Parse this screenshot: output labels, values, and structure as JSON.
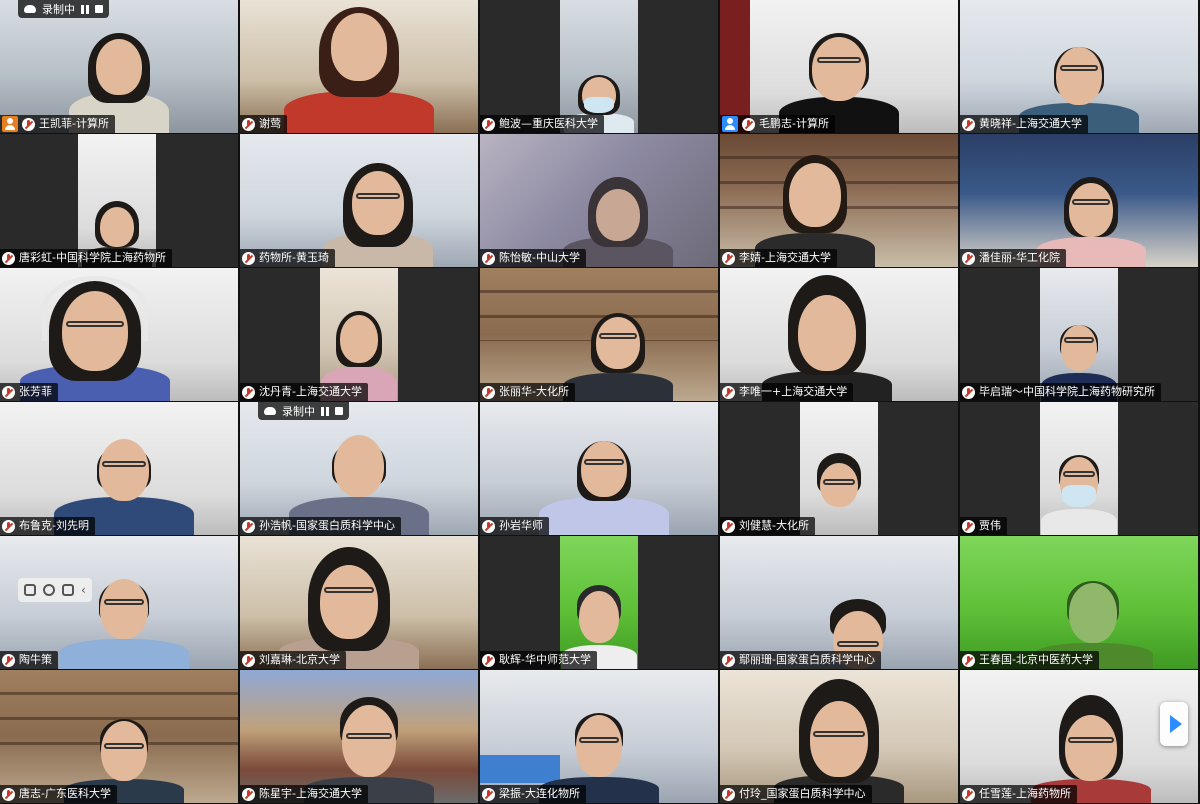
{
  "meeting": {
    "recording_label": "录制中",
    "participants": [
      {
        "name": "王凯菲-计算所",
        "host_badge": "orange",
        "recording": true
      },
      {
        "name": "谢莺"
      },
      {
        "name": "鲍波—重庆医科大学"
      },
      {
        "name": "毛鹏志-计算所",
        "host_badge": "blue"
      },
      {
        "name": "黄晓祥-上海交通大学"
      },
      {
        "name": "唐彩虹-中国科学院上海药物所"
      },
      {
        "name": "药物所-黄玉琦"
      },
      {
        "name": "陈怡敏-中山大学"
      },
      {
        "name": "李婧-上海交通大学"
      },
      {
        "name": "潘佳丽-华工化院"
      },
      {
        "name": "张芳菲"
      },
      {
        "name": "沈丹青-上海交通大学"
      },
      {
        "name": "张丽华-大化所"
      },
      {
        "name": "李唯一+上海交通大学"
      },
      {
        "name": "毕启瑞～中国科学院上海药物研究所"
      },
      {
        "name": "布鲁克-刘先明"
      },
      {
        "name": "孙浩帆-国家蛋白质科学中心",
        "recording": true
      },
      {
        "name": "孙岩华师"
      },
      {
        "name": "刘健慧-大化所"
      },
      {
        "name": "贾伟"
      },
      {
        "name": "陶牛策",
        "view_toolbar": true
      },
      {
        "name": "刘嘉琳-北京大学"
      },
      {
        "name": "耿辉-华中师范大学"
      },
      {
        "name": "鄢丽珊-国家蛋白质科学中心"
      },
      {
        "name": "王春国-北京中医药大学"
      },
      {
        "name": "唐志-广东医科大学"
      },
      {
        "name": "陈星宇-上海交通大学"
      },
      {
        "name": "梁振-大连化物所"
      },
      {
        "name": "付玲_国家蛋白质科学中心"
      },
      {
        "name": "任雪莲-上海药物所"
      }
    ]
  },
  "colors": {
    "host_orange": "#e67e22",
    "host_blue": "#2d8cff",
    "muted_red": "#c0392b",
    "next_arrow": "#2d8cff"
  },
  "icons": {
    "mute": "mic-muted-icon",
    "host": "host-avatar-icon",
    "record": "cloud-record-icon",
    "pause": "pause-icon",
    "stop": "stop-icon",
    "next_page": "next-page-arrow-icon"
  }
}
